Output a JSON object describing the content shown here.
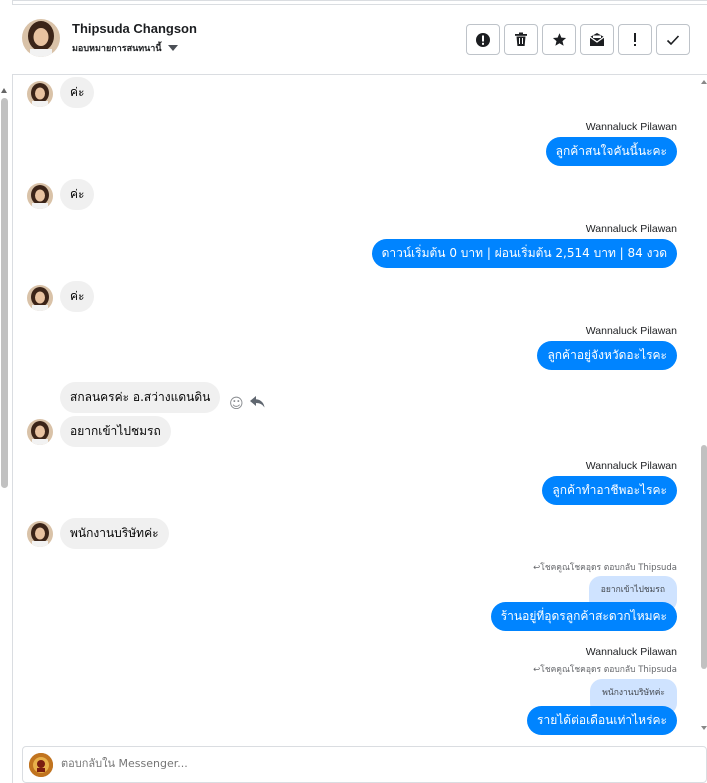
{
  "header": {
    "name": "Thipsuda Changson",
    "assign_label": "มอบหมายการสนทนานี้",
    "buttons": [
      {
        "name": "spam-report-button",
        "glyph": "!",
        "icon": "alert-circle-icon"
      },
      {
        "name": "delete-button",
        "glyph": "🗑",
        "icon": "trash-icon"
      },
      {
        "name": "star-button",
        "glyph": "★",
        "icon": "star-icon"
      },
      {
        "name": "mark-unread-button",
        "glyph": "✉",
        "icon": "envelope-icon"
      },
      {
        "name": "follow-up-button",
        "glyph": "!",
        "icon": "exclamation-icon"
      },
      {
        "name": "mark-done-button",
        "glyph": "✓",
        "icon": "check-icon"
      }
    ]
  },
  "messages": {
    "m1": "ค่ะ",
    "s1": "Wannaluck Pilawan",
    "o1": "ลูกค้าสนใจคันนี้นะคะ",
    "m2": "ค่ะ",
    "s2": "Wannaluck Pilawan",
    "o2": "ดาวน์เริ่มต้น 0 บาท | ผ่อนเริ่มต้น 2,514 บาท | 84 งวด",
    "m3": "ค่ะ",
    "s3": "Wannaluck Pilawan",
    "o3": "ลูกค้าอยู่จังหวัดอะไรคะ",
    "m4": "สกลนครค่ะ อ.สว่างแดนดิน",
    "m5": "อยากเข้าไปชมรถ",
    "s4": "Wannaluck Pilawan",
    "o4": "ลูกค้าทำอาชีพอะไรคะ",
    "m6": "พนักงานบริษัทค่ะ",
    "r1_info": "โชคคูณโชคอุดร ตอบกลับ Thipsuda",
    "r1_quote": "อยากเข้าไปชมรถ",
    "o5": "ร้านอยู่ที่อุดรลูกค้าสะดวกไหมคะ",
    "s5": "Wannaluck Pilawan",
    "r2_info": "โชคคูณโชคอุดร ตอบกลับ Thipsuda",
    "r2_quote": "พนักงานบริษัทค่ะ",
    "o6": "รายได้ต่อเดือนเท่าไหร่คะ"
  },
  "composer": {
    "placeholder": "ตอบกลับใน Messenger..."
  },
  "colors": {
    "outgoing_bubble": "#0084ff",
    "incoming_bubble": "#f0f0f0",
    "quote_bubble": "#cfe3ff"
  }
}
